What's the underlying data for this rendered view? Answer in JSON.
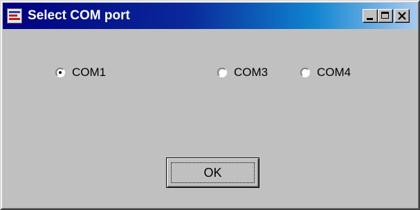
{
  "window": {
    "title": "Select COM port",
    "icon": "app-icon"
  },
  "titlebar_buttons": {
    "minimize": "minimize-icon",
    "maximize": "maximize-icon",
    "close": "close-icon"
  },
  "radios": [
    {
      "label": "COM1",
      "selected": true
    },
    {
      "label": "COM3",
      "selected": false
    },
    {
      "label": "COM4",
      "selected": false
    }
  ],
  "ok_button": {
    "label": "OK"
  },
  "colors": {
    "titlebar_start": "#000080",
    "titlebar_end": "#a6caf0",
    "face": "#c0c0c0"
  }
}
